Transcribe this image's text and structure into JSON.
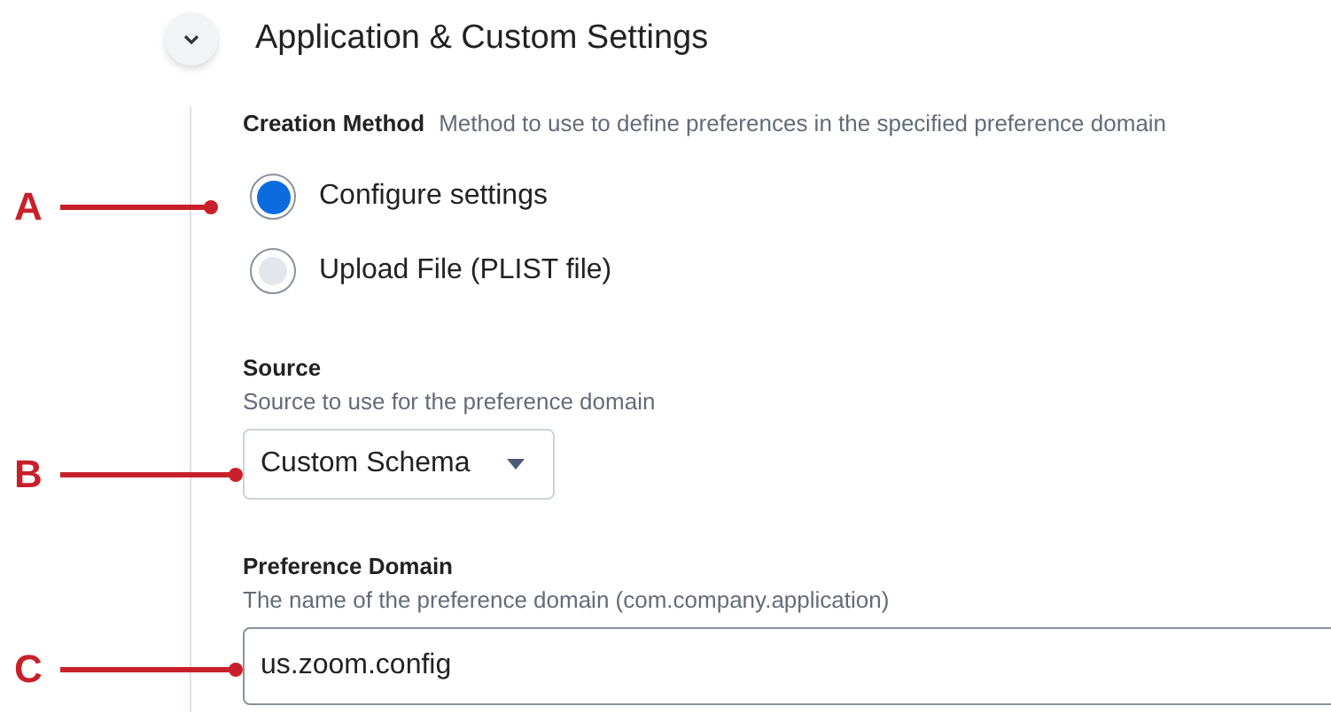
{
  "section": {
    "title": "Application & Custom Settings",
    "expanded": true
  },
  "creation_method": {
    "label": "Creation Method",
    "help": "Method to use to define preferences in the specified preference domain",
    "options": [
      {
        "label": "Configure settings",
        "selected": true
      },
      {
        "label": "Upload File (PLIST file)",
        "selected": false
      }
    ]
  },
  "source": {
    "label": "Source",
    "help": "Source to use for the preference domain",
    "value": "Custom Schema"
  },
  "preference_domain": {
    "label": "Preference Domain",
    "help": "The name of the preference domain (com.company.application)",
    "value": "us.zoom.config"
  },
  "callouts": [
    {
      "letter": "A",
      "kind": "radio"
    },
    {
      "letter": "B",
      "kind": "select"
    },
    {
      "letter": "C",
      "kind": "input"
    }
  ]
}
